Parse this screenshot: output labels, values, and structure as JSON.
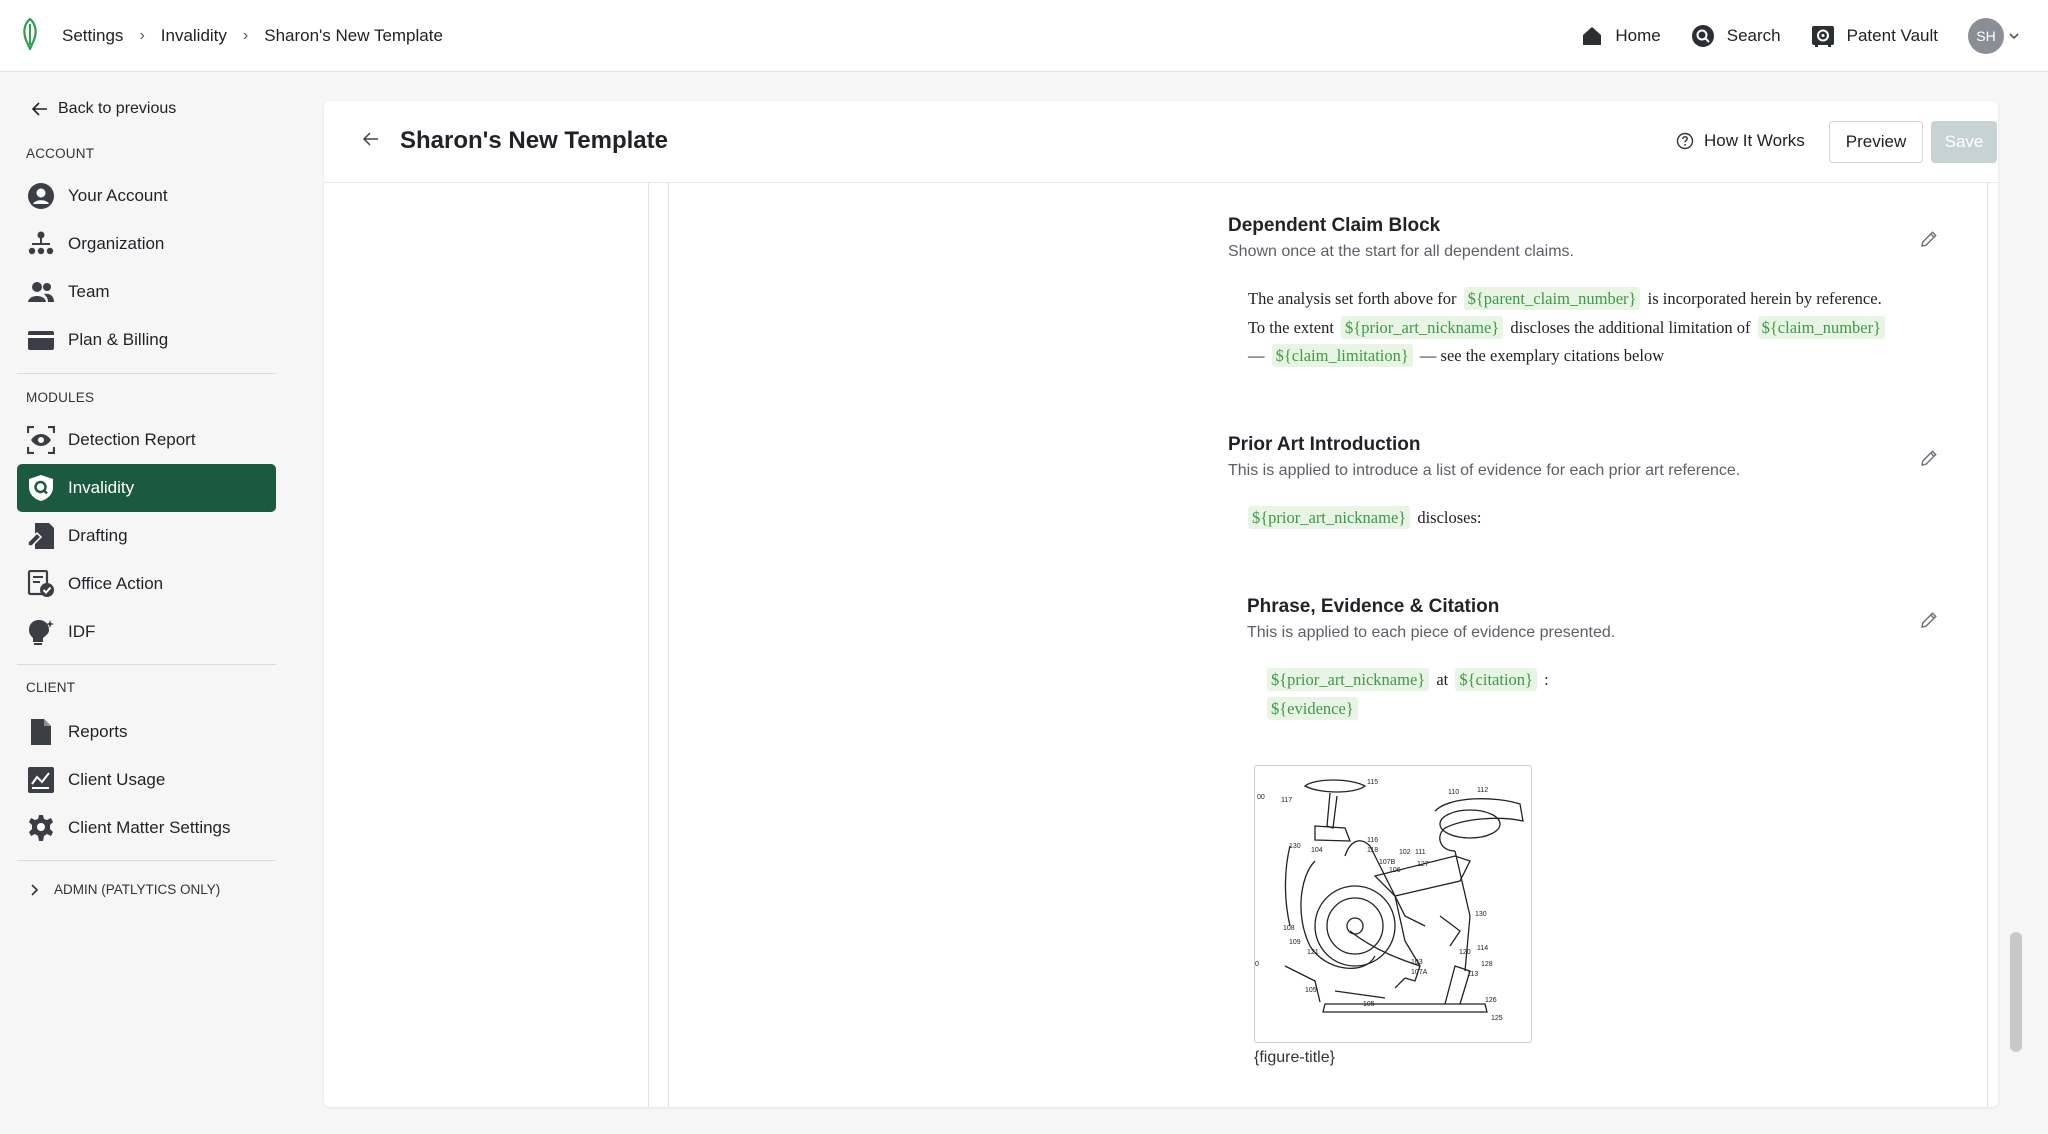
{
  "breadcrumb": [
    "Settings",
    "Invalidity",
    "Sharon's New Template"
  ],
  "topnav": {
    "home": "Home",
    "search": "Search",
    "vault": "Patent Vault",
    "avatar_initials": "SH"
  },
  "sidebar": {
    "back_label": "Back to previous",
    "account_label": "ACCOUNT",
    "account_items": [
      "Your Account",
      "Organization",
      "Team",
      "Plan & Billing"
    ],
    "modules_label": "MODULES",
    "module_items": [
      "Detection Report",
      "Invalidity",
      "Drafting",
      "Office Action",
      "IDF"
    ],
    "active_item": "Invalidity",
    "client_label": "CLIENT",
    "client_items": [
      "Reports",
      "Client Usage",
      "Client Matter Settings"
    ],
    "admin_label": "ADMIN (PATLYTICS ONLY)"
  },
  "header": {
    "title": "Sharon's New Template",
    "how_it_works": "How It Works",
    "preview": "Preview",
    "save": "Save"
  },
  "blocks": {
    "dependent": {
      "title": "Dependent Claim Block",
      "desc": "Shown once at the start for all dependent claims.",
      "t1": "The analysis set forth above for",
      "v1": "${parent_claim_number}",
      "t2": "is incorporated herein by reference.",
      "t3": "To the extent",
      "v2": "${prior_art_nickname}",
      "t4": "discloses the additional limitation of",
      "v3": "${claim_number}",
      "dash": "—",
      "v4": "${claim_limitation}",
      "t5": "— see the exemplary citations below"
    },
    "prior_art": {
      "title": "Prior Art Introduction",
      "desc": "This is applied to introduce a list of evidence for each prior art reference.",
      "v1": "${prior_art_nickname}",
      "t1": "discloses:"
    },
    "phrase": {
      "title": "Phrase, Evidence & Citation",
      "desc": "This is applied to each piece of evidence presented.",
      "v1": "${prior_art_nickname}",
      "t1": "at",
      "v2": "${citation}",
      "colon": ":",
      "v3": "${evidence}"
    },
    "figure_caption": "{figure-title}"
  },
  "figure_labels": {
    "l115": "115",
    "l110": "110",
    "l112": "112",
    "l00": "00",
    "l117": "117",
    "l130": "130",
    "l104": "104",
    "l116": "116",
    "l118": "118",
    "l102": "102",
    "l111": "111",
    "l107B": "107B",
    "l106": "106",
    "l127": "127",
    "l130b": "130",
    "l114": "114",
    "l120": "120",
    "l108": "108",
    "l109": "109",
    "l121": "121",
    "l103": "103",
    "l107A": "107A",
    "l128": "128",
    "l113": "113",
    "l0": "0",
    "l105": "105",
    "l105b": "105",
    "l126": "126",
    "l125": "125"
  },
  "colors": {
    "accent": "#1c5a40",
    "var_bg": "#e8f5e4",
    "var_text": "#3d9a45",
    "save_disabled": "#c7d3d2"
  }
}
